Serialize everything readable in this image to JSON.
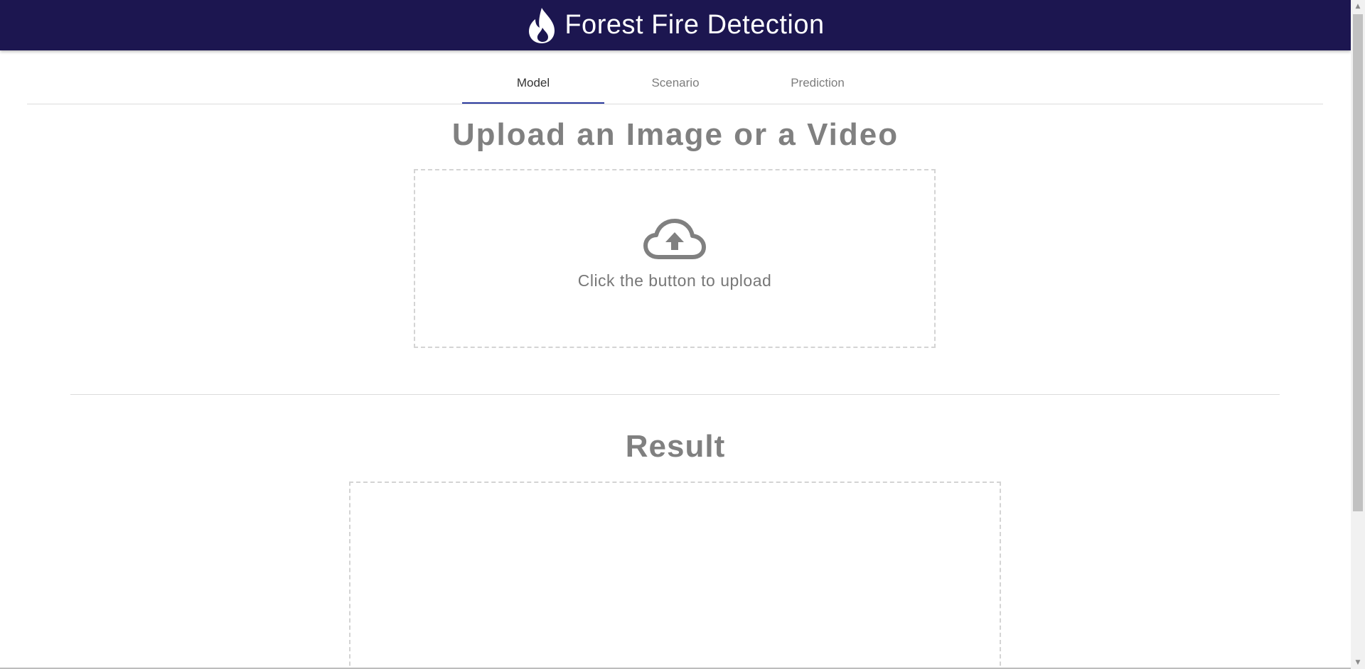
{
  "header": {
    "title": "Forest Fire Detection",
    "icon": "flame-icon",
    "background_color": "#1c1650"
  },
  "tabs": [
    {
      "label": "Model",
      "active": true
    },
    {
      "label": "Scenario",
      "active": false
    },
    {
      "label": "Prediction",
      "active": false
    }
  ],
  "upload": {
    "heading": "Upload an Image or a Video",
    "icon": "cloud-upload-icon",
    "instruction": "Click the button to upload"
  },
  "result": {
    "heading": "Result"
  },
  "colors": {
    "accent": "#2b3a9e",
    "text_muted": "#808080"
  }
}
